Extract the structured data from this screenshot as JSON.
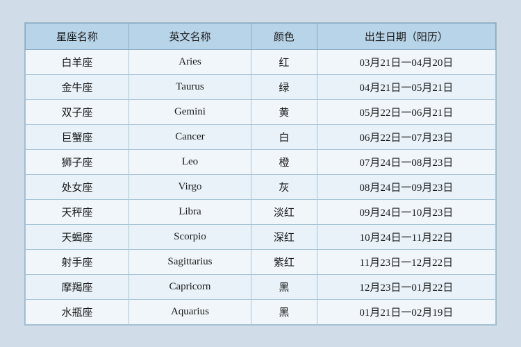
{
  "table": {
    "headers": [
      {
        "id": "chinese-name-header",
        "label": "星座名称"
      },
      {
        "id": "english-name-header",
        "label": "英文名称"
      },
      {
        "id": "color-header",
        "label": "颜色"
      },
      {
        "id": "date-header",
        "label": "出生日期（阳历）"
      }
    ],
    "rows": [
      {
        "chinese": "白羊座",
        "english": "Aries",
        "color": "红",
        "date": "03月21日一04月20日"
      },
      {
        "chinese": "金牛座",
        "english": "Taurus",
        "color": "绿",
        "date": "04月21日一05月21日"
      },
      {
        "chinese": "双子座",
        "english": "Gemini",
        "color": "黄",
        "date": "05月22日一06月21日"
      },
      {
        "chinese": "巨蟹座",
        "english": "Cancer",
        "color": "白",
        "date": "06月22日一07月23日"
      },
      {
        "chinese": "狮子座",
        "english": "Leo",
        "color": "橙",
        "date": "07月24日一08月23日"
      },
      {
        "chinese": "处女座",
        "english": "Virgo",
        "color": "灰",
        "date": "08月24日一09月23日"
      },
      {
        "chinese": "天秤座",
        "english": "Libra",
        "color": "淡红",
        "date": "09月24日一10月23日"
      },
      {
        "chinese": "天蝎座",
        "english": "Scorpio",
        "color": "深红",
        "date": "10月24日一11月22日"
      },
      {
        "chinese": "射手座",
        "english": "Sagittarius",
        "color": "紫红",
        "date": "11月23日一12月22日"
      },
      {
        "chinese": "摩羯座",
        "english": "Capricorn",
        "color": "黑",
        "date": "12月23日一01月22日"
      },
      {
        "chinese": "水瓶座",
        "english": "Aquarius",
        "color": "黑",
        "date": "01月21日一02月19日"
      }
    ]
  }
}
